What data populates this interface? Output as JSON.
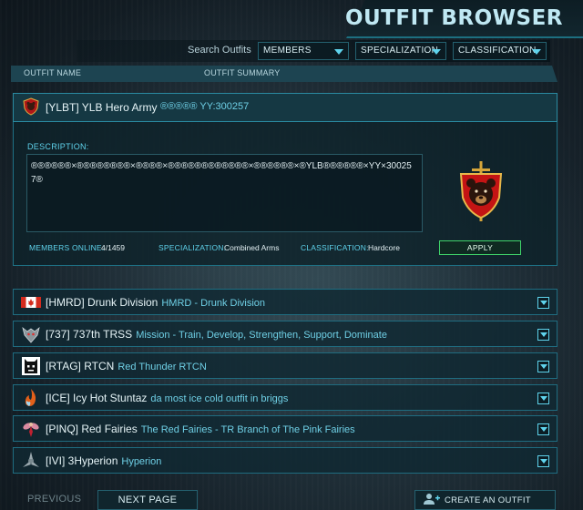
{
  "header": {
    "title": "OUTFIT BROWSER"
  },
  "filters": {
    "search_label": "Search Outfits",
    "members": "MEMBERS",
    "specialization": "SPECIALIZATION",
    "classification": "CLASSIFICATION"
  },
  "columns": {
    "name": "OUTFIT NAME",
    "summary": "OUTFIT SUMMARY"
  },
  "selected": {
    "name": "[YLBT] YLB Hero Army",
    "summary": "®®®®® YY:300257",
    "description_label": "DESCRIPTION:",
    "description": "®®®®®®×®®®®®®®®×®®®®×®®®®®®®®®®®®×®®®®®®×®YLB®®®®®®×YY×300257®",
    "members_online_label": "MEMBERS ONLINE:",
    "members_online": "4/1459",
    "specialization_label": "SPECIALIZATION:",
    "specialization": "Combined Arms",
    "classification_label": "CLASSIFICATION:",
    "classification": "Hardcore",
    "apply_label": "APPLY",
    "emblem_icon": "bear-shield-emblem-icon"
  },
  "outfits": [
    {
      "name": "[HMRD] Drunk Division",
      "summary": "HMRD - Drunk Division",
      "icon": "canada-flag-icon"
    },
    {
      "name": "[737] 737th TRSS",
      "summary": "Mission - Train, Develop, Strengthen, Support, Dominate",
      "icon": "wolf-emblem-icon"
    },
    {
      "name": "[RTAG] RTCN",
      "summary": "Red Thunder   RTCN",
      "icon": "robot-face-icon"
    },
    {
      "name": "[ICE] Icy Hot Stuntaz",
      "summary": "da most ice cold outfit in briggs",
      "icon": "fire-ice-icon"
    },
    {
      "name": "[PINQ] Red Fairies",
      "summary": "The Red Fairies - TR Branch of The Pink Fairies",
      "icon": "fairy-icon"
    },
    {
      "name": "[IVI] 3Hyperion",
      "summary": "Hyperion",
      "icon": "tri-blade-icon"
    }
  ],
  "footer": {
    "previous": "PREVIOUS",
    "next": "NEXT PAGE",
    "create": "CREATE AN OUTFIT"
  },
  "colors": {
    "accent": "#5fd3ec",
    "apply_border": "#3fd36a",
    "panel_border": "#1e7185"
  }
}
